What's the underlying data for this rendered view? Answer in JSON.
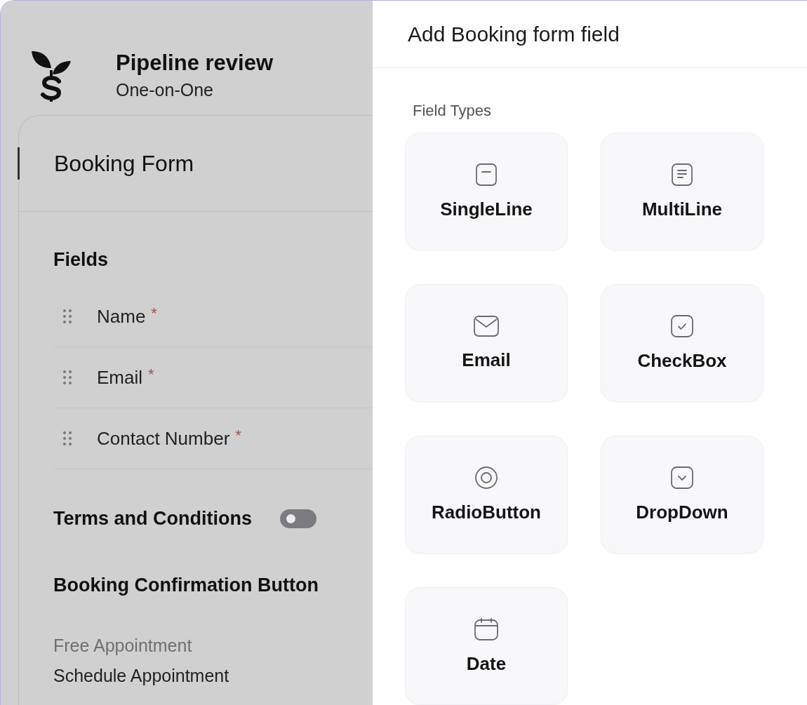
{
  "header": {
    "title": "Pipeline review",
    "subtitle": "One-on-One"
  },
  "nav": [
    {
      "label": "Booking Form",
      "selected": true
    }
  ],
  "fields_section": {
    "title": "Fields",
    "fields": [
      {
        "label": "Name",
        "required": true,
        "mark": "*"
      },
      {
        "label": "Email",
        "required": true,
        "mark": "*"
      },
      {
        "label": "Contact Number",
        "required": true,
        "mark": "*"
      }
    ]
  },
  "terms": {
    "label": "Terms and Conditions",
    "on": false
  },
  "confirmation": {
    "title": "Booking Confirmation Button",
    "caption": "Free Appointment",
    "value": "Schedule Appointment"
  },
  "panel": {
    "title": "Add Booking form field",
    "section": "Field Types",
    "field_types": [
      {
        "label": "SingleLine",
        "kind": "singleline"
      },
      {
        "label": "MultiLine",
        "kind": "multiline"
      },
      {
        "label": "Email",
        "kind": "email"
      },
      {
        "label": "CheckBox",
        "kind": "checkbox"
      },
      {
        "label": "RadioButton",
        "kind": "radio"
      },
      {
        "label": "DropDown",
        "kind": "dropdown"
      },
      {
        "label": "Date",
        "kind": "date"
      }
    ]
  }
}
